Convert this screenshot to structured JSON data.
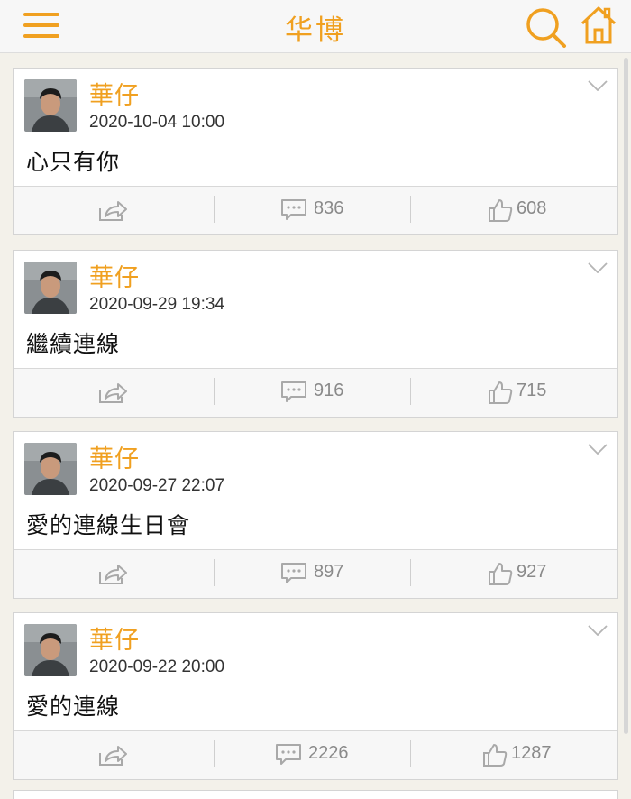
{
  "header": {
    "title": "华博",
    "menu_icon": "hamburger-icon",
    "search_icon": "search-icon",
    "home_icon": "home-icon",
    "accent_color": "#f0a020"
  },
  "posts": [
    {
      "username": "華仔",
      "timestamp": "2020-10-04 10:00",
      "text": "心只有你",
      "comments": "836",
      "likes": "608"
    },
    {
      "username": "華仔",
      "timestamp": "2020-09-29 19:34",
      "text": "繼續連線",
      "comments": "916",
      "likes": "715"
    },
    {
      "username": "華仔",
      "timestamp": "2020-09-27 22:07",
      "text": "愛的連線生日會",
      "comments": "897",
      "likes": "927"
    },
    {
      "username": "華仔",
      "timestamp": "2020-09-22 20:00",
      "text": "愛的連線",
      "comments": "2226",
      "likes": "1287"
    }
  ]
}
